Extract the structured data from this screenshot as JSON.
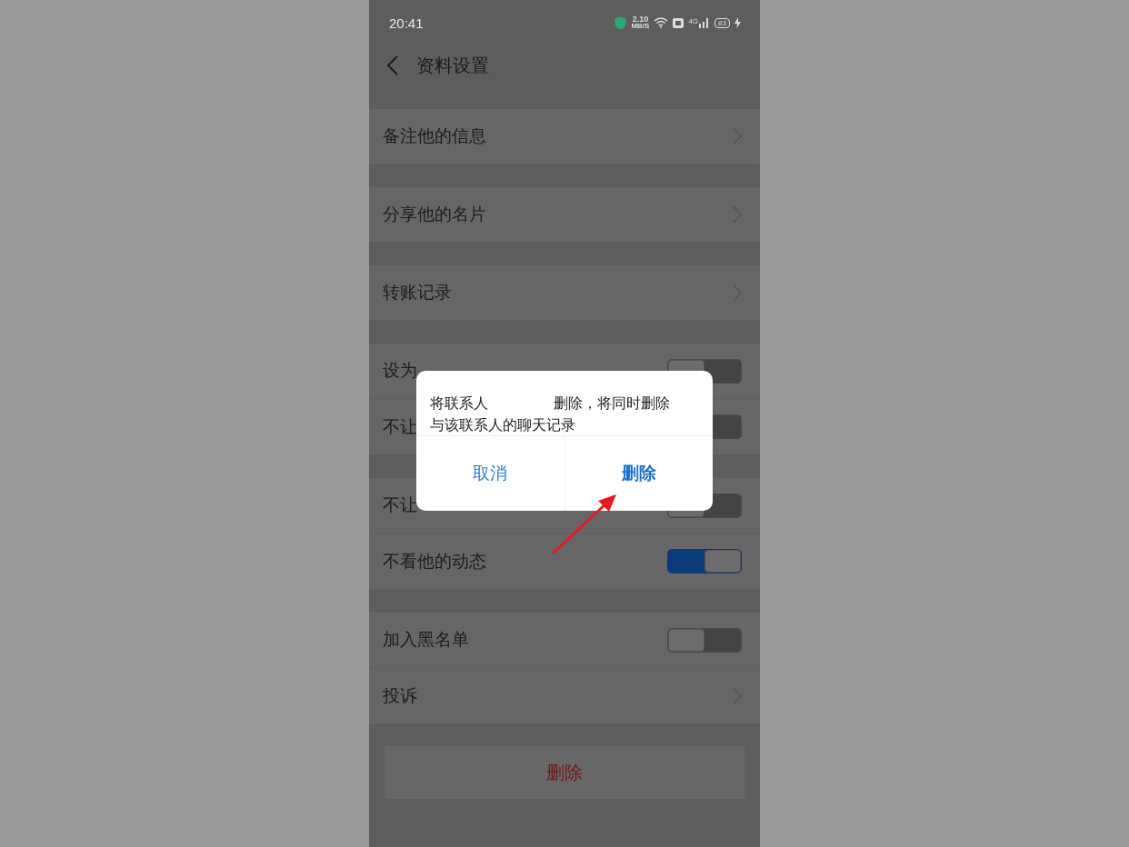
{
  "status_bar": {
    "time": "20:41",
    "speed": "2.10",
    "speed_unit": "MB/S",
    "network": "4G",
    "battery": "83"
  },
  "header": {
    "title": "资料设置"
  },
  "sections": [
    {
      "items": [
        {
          "kind": "link",
          "label": "备注他的信息"
        }
      ]
    },
    {
      "items": [
        {
          "kind": "link",
          "label": "分享他的名片"
        }
      ]
    },
    {
      "items": [
        {
          "kind": "link",
          "label": "转账记录"
        }
      ]
    },
    {
      "items": [
        {
          "kind": "toggle",
          "label": "设为",
          "on": false
        },
        {
          "kind": "toggle",
          "label": "不让",
          "on": false
        }
      ]
    },
    {
      "items": [
        {
          "kind": "toggle",
          "label": "不让",
          "on": false
        },
        {
          "kind": "toggle",
          "label": "不看他的动态",
          "on": true
        }
      ]
    },
    {
      "items": [
        {
          "kind": "toggle",
          "label": "加入黑名单",
          "on": false
        },
        {
          "kind": "link",
          "label": "投诉"
        }
      ]
    }
  ],
  "delete_button": "删除",
  "dialog": {
    "message_start": "将联系人",
    "message_rest": "删除，将同时删除与该联系人的聊天记录",
    "buttons": [
      {
        "label": "取消",
        "kind": "cancel"
      },
      {
        "label": "删除",
        "kind": "confirm"
      }
    ]
  }
}
